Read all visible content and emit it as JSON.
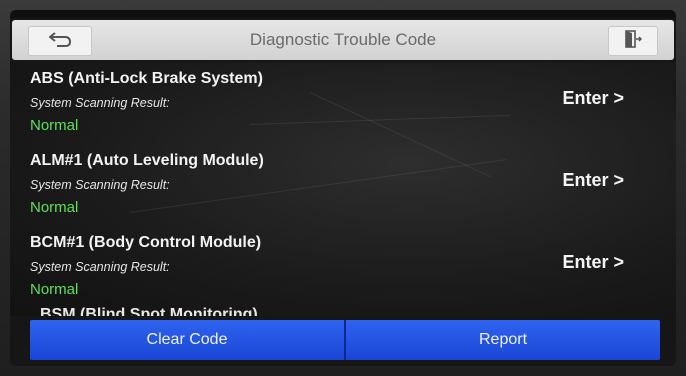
{
  "header": {
    "title": "Diagnostic Trouble Code",
    "back_icon": "back-arrow-icon",
    "exit_icon": "exit-door-icon"
  },
  "systems": [
    {
      "name": "ABS (Anti-Lock Brake System)",
      "result_label": "System Scanning Result:",
      "status": "Normal",
      "enter_label": "Enter >"
    },
    {
      "name": "ALM#1 (Auto Leveling Module)",
      "result_label": "System Scanning Result:",
      "status": "Normal",
      "enter_label": "Enter >"
    },
    {
      "name": "BCM#1 (Body Control Module)",
      "result_label": "System Scanning Result:",
      "status": "Normal",
      "enter_label": "Enter >"
    }
  ],
  "partial_item": "BSM (Blind Spot Monitoring)",
  "footer": {
    "clear_label": "Clear Code",
    "report_label": "Report"
  },
  "colors": {
    "normal_status": "#5ee05a",
    "button_blue": "#2f63f0",
    "title_bar": "#dcdcdc"
  }
}
